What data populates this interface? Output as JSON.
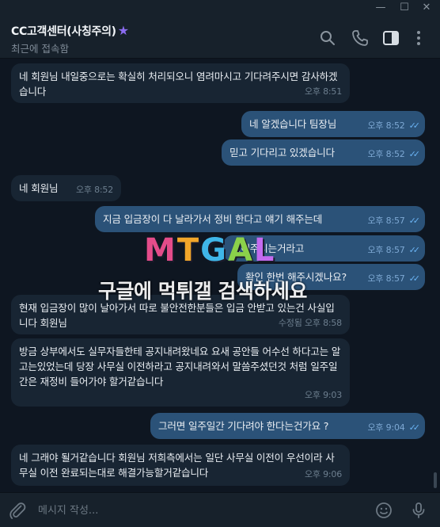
{
  "window": {
    "minimize": "—",
    "maximize": "☐",
    "close": "✕"
  },
  "header": {
    "title": "CC고객센터(사칭주의)",
    "status": "최근에 접속함"
  },
  "messages": [
    {
      "dir": "in",
      "text": "네 회원님 내일중으로는 확실히 처리되오니 염려마시고 기다려주시면 감사하겠습니다",
      "time": "오후 8:51"
    },
    {
      "dir": "out",
      "text": "네 알겠습니다 팀장님",
      "time": "오후 8:52"
    },
    {
      "dir": "out",
      "text": "믿고 기다리고 있겠습니다",
      "time": "오후 8:52"
    },
    {
      "dir": "in",
      "text": "네 회원님",
      "time": "오후 8:52"
    },
    {
      "dir": "out",
      "text": "지금 입금장이 다 날라가서 정비 한다고 얘기 해주는데",
      "time": "오후 8:57"
    },
    {
      "dir": "out",
      "text": "…해주시는거라고",
      "time": "오후 8:57"
    },
    {
      "dir": "out",
      "text": "확인 한번 해주시겠나요?",
      "time": "오후 8:57"
    },
    {
      "dir": "in",
      "text": "현재 입금장이 많이 날아가서 따로 불안전한분들은 입금 안받고 있는건 사실입니다 회원님",
      "time": "수정됨 오후 8:58"
    },
    {
      "dir": "in",
      "text": "방금 상부에서도 실무자들한테 공지내려왔네요 요새 공안들 어수선 하다고는 알고는있었는데 당장 사무실 이전하라고 공지내려와서 말씀주셨던것 처럼 일주일간은 재정비 들어가야 할거같습니다",
      "time": "오후 9:03"
    },
    {
      "dir": "out",
      "text": "그러면 일주일간 기다려야 한다는건가요 ?",
      "time": "오후 9:04"
    },
    {
      "dir": "in",
      "text": "네 그래야 될거같습니다 회원님 저희측에서는 일단 사무실 이전이 우선이라 사무실 이전 완료되는대로 해결가능할거같습니다",
      "time": "오후 9:06"
    }
  ],
  "watermark": {
    "logo": "MTGAL",
    "text": "구글에 먹튀갤 검색하세요"
  },
  "composer": {
    "placeholder": "메시지 작성..."
  },
  "colors": {
    "bg": "#0e1621",
    "incoming": "#182533",
    "outgoing": "#2b5278",
    "accent": "#6ab3f3"
  },
  "icons": [
    "search-icon",
    "phone-icon",
    "sidebar-toggle-icon",
    "more-vertical-icon",
    "attach-icon",
    "emoji-icon",
    "microphone-icon"
  ]
}
